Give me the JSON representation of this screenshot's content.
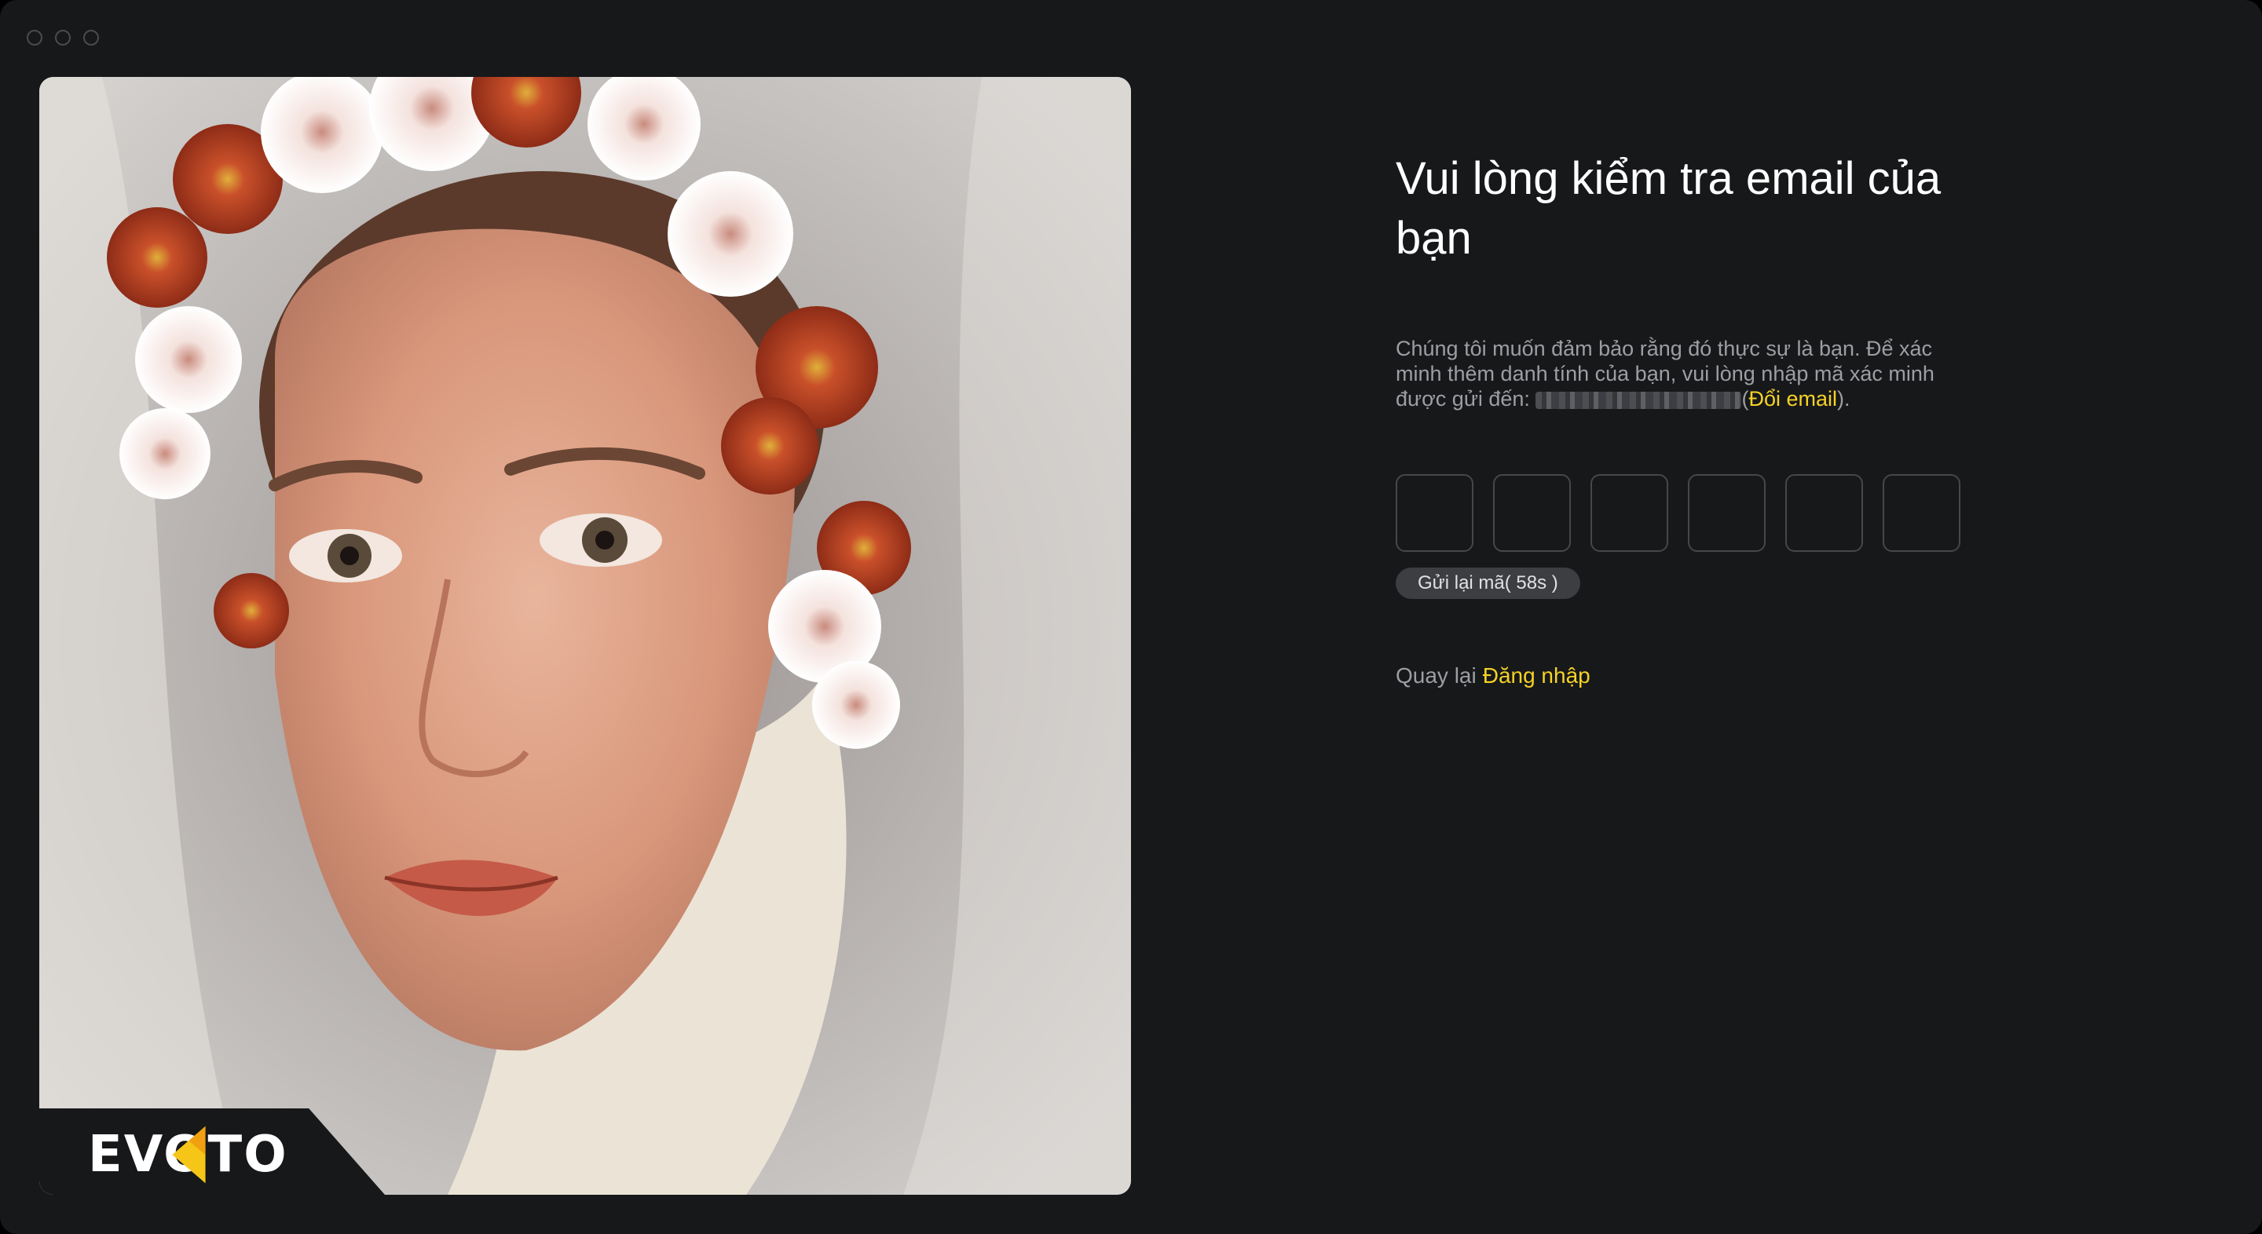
{
  "window": {
    "controls": [
      "close",
      "minimize",
      "maximize"
    ]
  },
  "hero": {
    "image_subject": "portrait of a woman wearing a white veil and a crown of orange and pink chrysanthemums",
    "brand": "EVOTO",
    "brand_colors": {
      "mark_yellow": "#f5c518",
      "mark_orange": "#f0a010"
    }
  },
  "form": {
    "title": "Vui lòng kiểm tra email của bạn",
    "description_prefix": "Chúng tôi muốn đảm bảo rằng đó thực sự là bạn. Để xác minh thêm danh tính của bạn, vui lòng nhập mã xác minh được gửi đến: ",
    "description_open_paren": "(",
    "change_email_link": "Đổi email",
    "description_suffix": ").",
    "code_length": 6,
    "resend_label": "Gửi lại mã( 58s )",
    "back_text": "Quay lại",
    "login_link": "Đăng nhập"
  },
  "colors": {
    "background": "#17181a",
    "accent": "#f5d227",
    "text_primary": "#ffffff",
    "text_secondary": "#9c9ea3",
    "input_border": "#45474b",
    "resend_bg": "#3c3e42"
  }
}
